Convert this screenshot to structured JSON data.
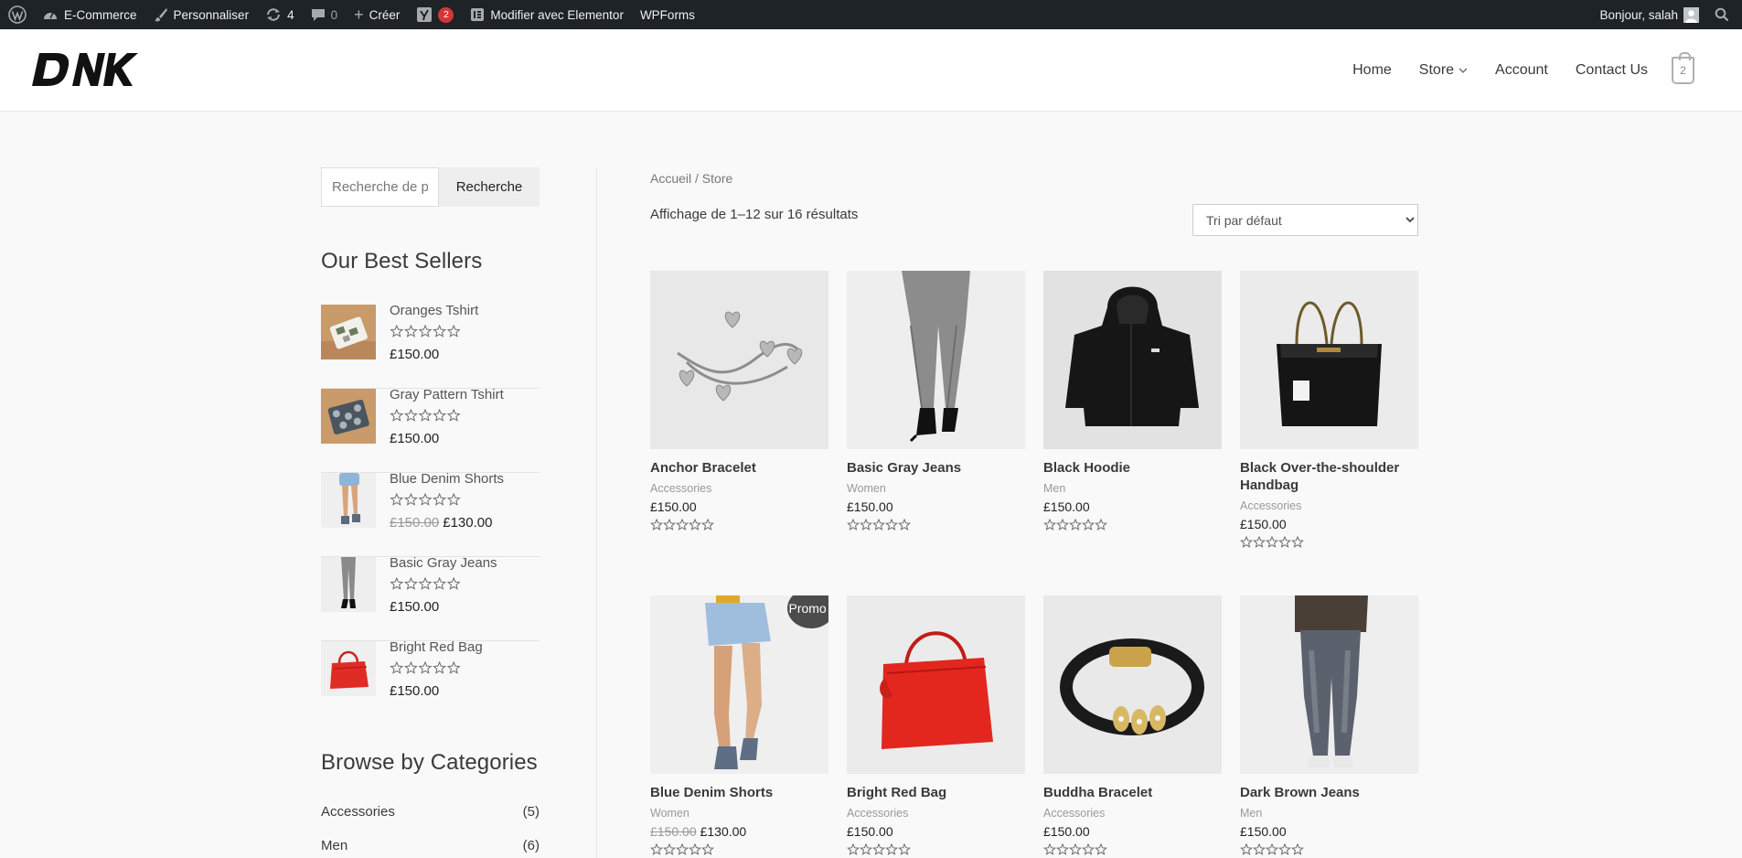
{
  "admin_bar": {
    "site_name": "E-Commerce",
    "customize": "Personnaliser",
    "updates_count": "4",
    "comments_count": "0",
    "new": "Créer",
    "yoast_badge": "2",
    "elementor": "Modifier avec Elementor",
    "wpforms": "WPForms",
    "greeting": "Bonjour, salah"
  },
  "header": {
    "logo_text": "DNK",
    "nav": {
      "home": "Home",
      "store": "Store",
      "account": "Account",
      "contact": "Contact Us"
    },
    "cart_count": "2"
  },
  "sidebar": {
    "search_placeholder": "Recherche de p",
    "search_button": "Recherche",
    "best_sellers_title": "Our Best Sellers",
    "best_sellers": [
      {
        "name": "Oranges Tshirt",
        "price": "£150.00",
        "old_price": "",
        "rating": 0
      },
      {
        "name": "Gray Pattern Tshirt",
        "price": "£150.00",
        "old_price": "",
        "rating": 0
      },
      {
        "name": "Blue Denim Shorts",
        "price": "£130.00",
        "old_price": "£150.00",
        "rating": 0
      },
      {
        "name": "Basic Gray Jeans",
        "price": "£150.00",
        "old_price": "",
        "rating": 0
      },
      {
        "name": "Bright Red Bag",
        "price": "£150.00",
        "old_price": "",
        "rating": 0
      }
    ],
    "categories_title": "Browse by Categories",
    "categories": [
      {
        "name": "Accessories",
        "count": "(5)"
      },
      {
        "name": "Men",
        "count": "(6)"
      }
    ]
  },
  "main": {
    "breadcrumb": "Accueil / Store",
    "result_count": "Affichage de 1–12 sur 16 résultats",
    "sort_selected": "Tri par défaut",
    "products": [
      {
        "name": "Anchor Bracelet",
        "category": "Accessories",
        "price": "£150.00",
        "old_price": "",
        "promo": "",
        "rating": 0
      },
      {
        "name": "Basic Gray Jeans",
        "category": "Women",
        "price": "£150.00",
        "old_price": "",
        "promo": "",
        "rating": 0
      },
      {
        "name": "Black Hoodie",
        "category": "Men",
        "price": "£150.00",
        "old_price": "",
        "promo": "",
        "rating": 0
      },
      {
        "name": "Black Over-the-shoulder Handbag",
        "category": "Accessories",
        "price": "£150.00",
        "old_price": "",
        "promo": "",
        "rating": 0
      },
      {
        "name": "Blue Denim Shorts",
        "category": "Women",
        "price": "£130.00",
        "old_price": "£150.00",
        "promo": "Promo !",
        "rating": 0
      },
      {
        "name": "Bright Red Bag",
        "category": "Accessories",
        "price": "£150.00",
        "old_price": "",
        "promo": "",
        "rating": 0
      },
      {
        "name": "Buddha Bracelet",
        "category": "Accessories",
        "price": "£150.00",
        "old_price": "",
        "promo": "",
        "rating": 0
      },
      {
        "name": "Dark Brown Jeans",
        "category": "Men",
        "price": "£150.00",
        "old_price": "",
        "promo": "",
        "rating": 0
      }
    ]
  },
  "colors": {
    "admin_bar_bg": "#1d2327",
    "badge_red": "#d63638",
    "promo_bg": "#4c4c4c",
    "page_bg": "#f9f9f9"
  }
}
